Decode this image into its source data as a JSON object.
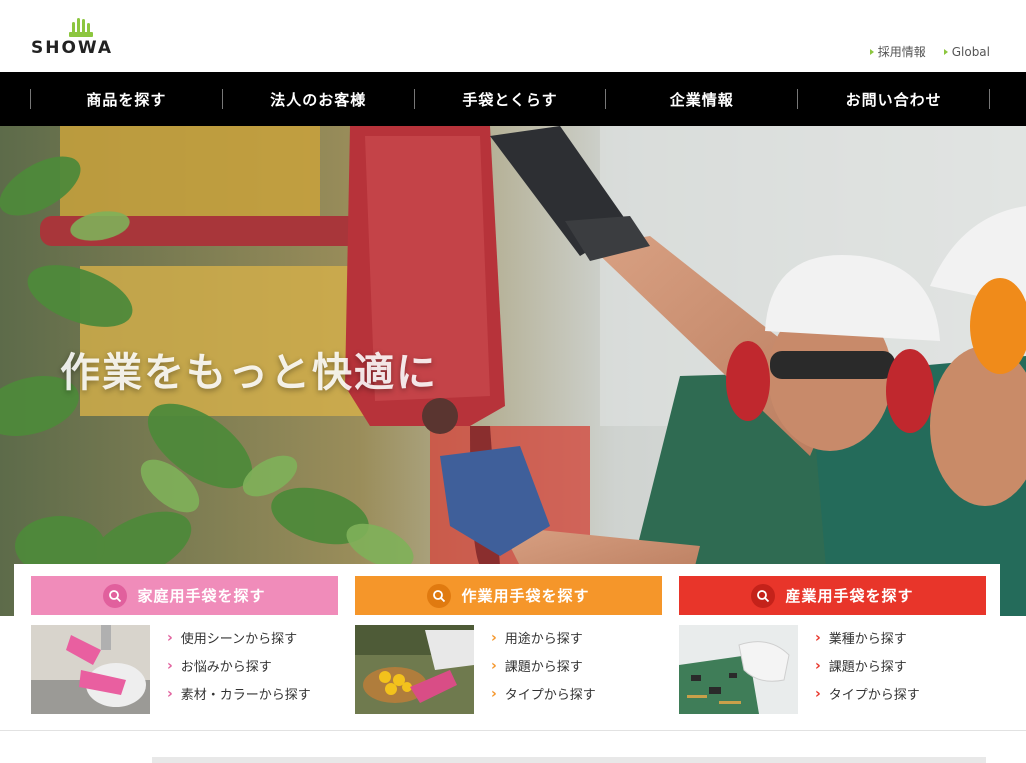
{
  "brand": {
    "name": "SHOWA",
    "logo_color": "#8cc63f"
  },
  "utility_links": [
    {
      "label": "採用情報"
    },
    {
      "label": "Global"
    }
  ],
  "nav": [
    {
      "label": "商品を探す"
    },
    {
      "label": "法人のお客様"
    },
    {
      "label": "手袋とくらす"
    },
    {
      "label": "企業情報"
    },
    {
      "label": "お問い合わせ"
    }
  ],
  "hero": {
    "headline": "作業をもっと快適に"
  },
  "categories": [
    {
      "title": "家庭用手袋を探す",
      "color": "#f08cba",
      "links": [
        "使用シーンから探す",
        "お悩みから探す",
        "素材・カラーから探す"
      ]
    },
    {
      "title": "作業用手袋を探す",
      "color": "#f5962a",
      "links": [
        "用途から探す",
        "課題から探す",
        "タイプから探す"
      ]
    },
    {
      "title": "産業用手袋を探す",
      "color": "#e8352a",
      "links": [
        "業種から探す",
        "課題から探す",
        "タイプから探す"
      ]
    }
  ],
  "icons": {
    "category_header": "search-icon",
    "link_bullet": "chevron-right-icon",
    "utility_bullet": "triangle-right-icon"
  }
}
